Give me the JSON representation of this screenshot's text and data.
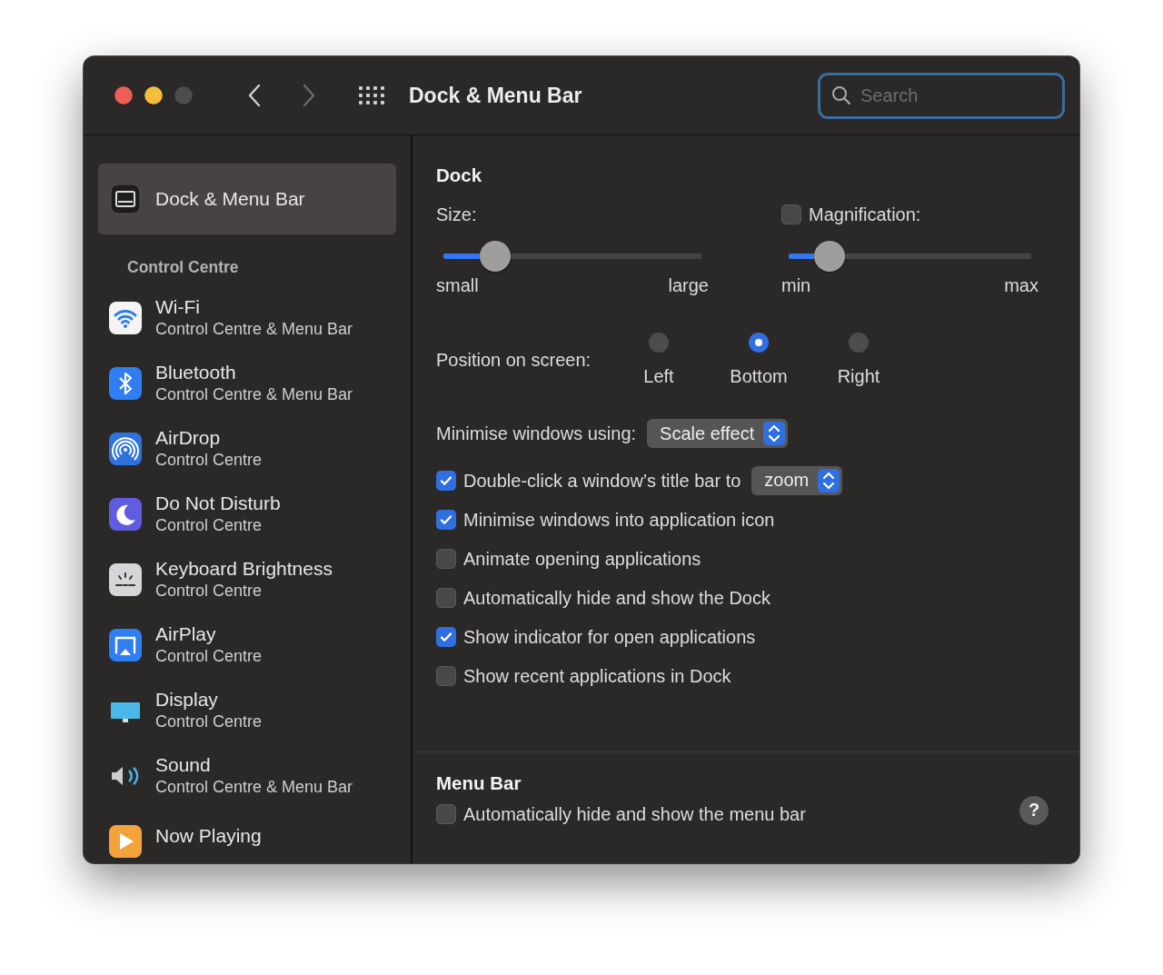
{
  "window": {
    "title": "Dock & Menu Bar"
  },
  "toolbar": {
    "search": {
      "placeholder": "Search"
    }
  },
  "sidebar": {
    "top_item": {
      "title": "Dock & Menu Bar",
      "selected": true
    },
    "section_heading": "Control Centre",
    "items": [
      {
        "title": "Wi-Fi",
        "subtitle": "Control Centre & Menu Bar",
        "selected": false
      },
      {
        "title": "Bluetooth",
        "subtitle": "Control Centre & Menu Bar",
        "selected": false
      },
      {
        "title": "AirDrop",
        "subtitle": "Control Centre",
        "selected": false
      },
      {
        "title": "Do Not Disturb",
        "subtitle": "Control Centre",
        "selected": false
      },
      {
        "title": "Keyboard Brightness",
        "subtitle": "Control Centre",
        "selected": false
      },
      {
        "title": "AirPlay",
        "subtitle": "Control Centre",
        "selected": false
      },
      {
        "title": "Display",
        "subtitle": "Control Centre",
        "selected": false
      },
      {
        "title": "Sound",
        "subtitle": "Control Centre & Menu Bar",
        "selected": false
      },
      {
        "title": "Now Playing",
        "selected": false
      }
    ]
  },
  "dock": {
    "heading": "Dock",
    "size": {
      "label": "Size:",
      "level": 0.2,
      "min_label": "small",
      "max_label": "large"
    },
    "magnification": {
      "label": "Magnification:",
      "checked": false,
      "level": 0.17,
      "min_label": "min",
      "max_label": "max"
    },
    "position": {
      "label": "Position on screen:",
      "options": [
        {
          "label": "Left",
          "selected": false
        },
        {
          "label": "Bottom",
          "selected": true
        },
        {
          "label": "Right",
          "selected": false
        }
      ]
    },
    "minimise": {
      "label": "Minimise windows using:",
      "value": "Scale effect"
    },
    "options": [
      {
        "kind": "popup",
        "label": "Double-click a window’s title bar to",
        "checked": true,
        "value": "zoom"
      },
      {
        "kind": "checkbox",
        "label": "Minimise windows into application icon",
        "checked": true
      },
      {
        "kind": "checkbox",
        "label": "Animate opening applications",
        "checked": false
      },
      {
        "kind": "checkbox",
        "label": "Automatically hide and show the Dock",
        "checked": false
      },
      {
        "kind": "checkbox",
        "label": "Show indicator for open applications",
        "checked": true
      },
      {
        "kind": "checkbox",
        "label": "Show recent applications in Dock",
        "checked": false
      }
    ]
  },
  "menu_bar": {
    "heading": "Menu Bar",
    "options": [
      {
        "label": "Automatically hide and show the menu bar",
        "checked": false
      }
    ],
    "help": "?"
  }
}
